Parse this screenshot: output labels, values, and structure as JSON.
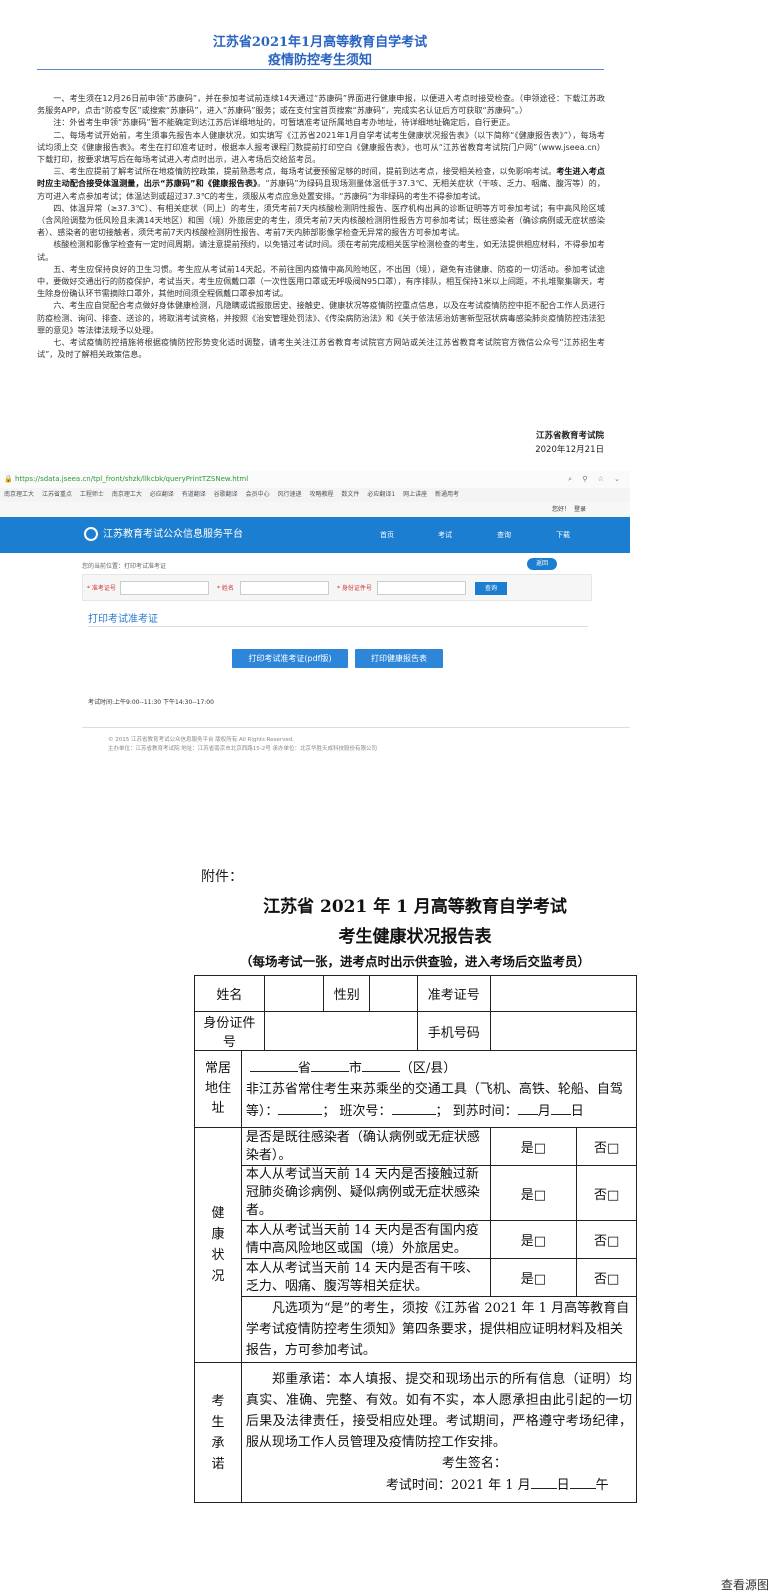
{
  "notice": {
    "title_line1": "江苏省2021年1月高等教育自学考试",
    "title_line2": "疫情防控考生须知",
    "p1": "一、考生须在12月26日前申领“苏康码”，并在参加考试前连续14天通过“苏康码”界面进行健康申报，以便进入考点时接受检查。（申领途径：下载江苏政务服务APP，点击“防疫专区”或搜索“苏康码”，进入“苏康码”服务；或在支付宝首页搜索“苏康码”，完成实名认证后方可获取“苏康码”。）",
    "p2": "注：外省考生申领“苏康码”暂不能确定到达江苏后详细地址的，可暂填准考证所属地自考办地址，待详细地址确定后，自行更正。",
    "p3": "二、每场考试开始前，考生须事先报告本人健康状况，如实填写《江苏省2021年1月自学考试考生健康状况报告表》（以下简称“《健康报告表》”），每场考试均须上交《健康报告表》。考生在打印准考证时，根据本人报考课程门数提前打印空白《健康报告表》，也可从“江苏省教育考试院门户网”（www.jseea.cn）下载打印，按要求填写后在每场考试进入考点时出示，进入考场后交给监考员。",
    "p4a": "三、考生应提前了解考试所在地疫情防控政策，提前熟悉考点，每场考试要预留足够的时间，提前到达考点，接受相关检查，以免影响考试。",
    "p4b": "考生进入考点时应主动配合接受体温测量，出示“苏康码”和《健康报告表》",
    "p4c": "。“苏康码”为绿码且现场测量体温低于37.3℃、无相关症状（干咳、乏力、咽痛、腹泻等）的，方可进入考点参加考试；体温达到或超过37.3℃的考生，须服从考点应急处置安排。“苏康码”为非绿码的考生不得参加考试。",
    "p5": "四、体温异常（≥37.3℃）、有相关症状（同上）的考生，须凭考前7天内核酸检测阴性报告、医疗机构出具的诊断证明等方可参加考试；有中高风险区域（含风险调整为低风险且未满14天地区）和国（境）外旅居史的考生，须凭考前7天内核酸检测阴性报告方可参加考试；既往感染者（确诊病例或无症状感染者）、感染者的密切接触者，须凭考前7天内核酸检测阴性报告、考前7天内肺部影像学检查无异常的报告方可参加考试。",
    "p6": "核酸检测和影像学检查有一定时间周期，请注意提前预约，以免错过考试时间。须在考前完成相关医学检测检查的考生，如无法提供相应材料，不得参加考试。",
    "p7": "五、考生应保持良好的卫生习惯。考生应从考试前14天起，不前往国内疫情中高风险地区，不出国（境），避免有违健康、防疫的一切活动。参加考试途中，要做好交通出行的防疫保护，考试当天，考生应佩戴口罩（一次性医用口罩或无呼吸阀N95口罩），有序排队，相互保持1米以上间距，不扎堆聚集聊天，考生除身份确认环节需摘除口罩外，其他时间须全程佩戴口罩参加考试。",
    "p8": "六、考生应自觉配合考点做好身体健康检测，凡隐瞒或谎报旅居史、接触史、健康状况等疫情防控重点信息，以及在考试疫情防控中拒不配合工作人员进行防疫检测、询问、排查、送诊的，将取消考试资格，并按照《治安管理处罚法》、《传染病防治法》和《关于依法惩治妨害新型冠状病毒感染肺炎疫情防控违法犯罪的意见》等法律法规予以处理。",
    "p9": "七、考试疫情防控措施将根据疫情防控形势变化适时调整，请考生关注江苏省教育考试院官方网站或关注江苏省教育考试院官方微信公众号“江苏招生考试”，及时了解相关政策信息。",
    "issuer": "江苏省教育考试院",
    "date": "2020年12月21日"
  },
  "browser": {
    "url": "https://sdata.jseea.cn/tpl_front/shzk/llkcbk/queryPrintTZSNew.html",
    "bookmarks": [
      "南京理工大",
      "江苏省重点",
      "工程师士",
      "南京理工大",
      "必应翻译",
      "有道翻译",
      "谷歌翻译",
      "会员中心",
      "风行速递",
      "攻略教程",
      "数文件",
      "必应翻译1",
      "网上讲座",
      "新通用考"
    ],
    "top_note": "您好！",
    "login": "登录",
    "site_name": "江苏教育考试公众信息服务平台",
    "nav": [
      "首页",
      "考试",
      "查询",
      "下载"
    ],
    "breadcrumb": "您的当前位置：打印考试准考证",
    "back_label": "返回",
    "field_exam_no": "* 准考证号",
    "field_name": "* 姓名",
    "field_id": "* 身份证件号",
    "query_label": "查询",
    "page_title": "打印考试准考证",
    "btn_print_ticket": "打印考试准考证(pdf版)",
    "btn_print_health": "打印健康报告表",
    "print_time": "考试时间:上午9:00--11:30 下午14:30--17:00",
    "footer_line1": "© 2015 江苏省教育考试公众信息服务平台 版权所有 All Rights Reserved.",
    "footer_line2": "主办单位：江苏省教育考试院 地址：江苏省南京市北京西路15-2号 承办单位：北京华胜天成科技股份有限公司"
  },
  "form": {
    "attachment": "附件：",
    "title1": "江苏省 2021 年 1 月高等教育自学考试",
    "title2": "考生健康状况报告表",
    "subtitle": "（每场考试一张，进考点时出示供查验，进入考场后交监考员）",
    "name_label": "姓名",
    "gender_label": "性别",
    "exam_no_label": "准考证号",
    "id_label": "身份证件号",
    "phone_label": "手机号码",
    "address_label": "常居地住址",
    "addr_line1_a": "省",
    "addr_line1_b": "市",
    "addr_line1_c": "（区/县）",
    "addr_line2": "非江苏省常住考生来苏乘坐的交通工具（飞机、高铁、轮船、自驾等）：",
    "addr_shift": "； 班次号：",
    "addr_arrive": "； 到苏时间：",
    "addr_month": "月",
    "addr_day": "日",
    "health_label": "健康状况",
    "q1": "是否是既往感染者（确认病例或无症状感染者）。",
    "q2": "本人从考试当天前 14 天内是否接触过新冠肺炎确诊病例、疑似病例或无症状感染者。",
    "q3": "本人从考试当天前 14 天内是否有国内疫情中高风险地区或国（境）外旅居史。",
    "q4": "本人从考试当天前 14 天内是否有干咳、乏力、咽痛、腹泻等相关症状。",
    "yes": "是□",
    "no": "否□",
    "note": "凡选项为“是”的考生，须按《江苏省 2021 年 1 月高等教育自学考试疫情防控考生须知》第四条要求，提供相应证明材料及相关报告，方可参加考试。",
    "pledge_label": "考生承诺",
    "pledge": "郑重承诺：本人填报、提交和现场出示的所有信息（证明）均真实、准确、完整、有效。如有不实，本人愿承担由此引起的一切后果及法律责任，接受相应处理。考试期间，严格遵守考场纪律，服从现场工作人员管理及疫情防控工作安排。",
    "sign": "考生签名：",
    "exam_time_a": "考试时间：2021 年 1 月",
    "exam_time_b": "日",
    "exam_time_c": "午"
  },
  "corner_text": "查看源图"
}
